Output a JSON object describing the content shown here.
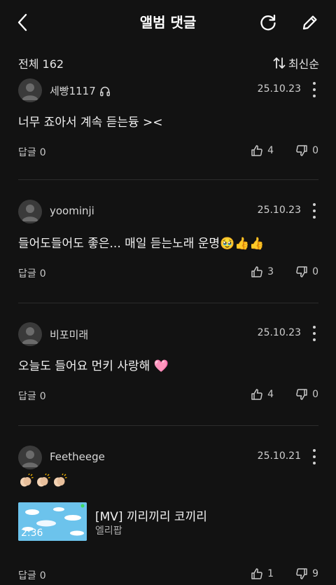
{
  "header": {
    "title": "앨범 댓글",
    "back_icon": "chevron-left-icon",
    "refresh_icon": "refresh-icon",
    "edit_icon": "pencil-icon"
  },
  "summary": {
    "total_label": "전체 162",
    "sort_label": "최신순",
    "sort_icon": "sort-arrows-icon"
  },
  "comments": [
    {
      "username": "세빵1117",
      "has_headphone_badge": true,
      "date": "25.10.23",
      "text": "너무 죠아서 계속 듣는듕 ><",
      "reply_label": "답글",
      "reply_count": "0",
      "likes": "4",
      "dislikes": "0"
    },
    {
      "username": "yoominji",
      "date": "25.10.23",
      "text": "들어도들어도 좋은... 매일 듣는노래 운명🥹👍👍",
      "reply_label": "답글",
      "reply_count": "0",
      "likes": "3",
      "dislikes": "0"
    },
    {
      "username": "비포미래",
      "date": "25.10.23",
      "text": "오늘도 들어요 먼키 사랑해 🩷",
      "reply_label": "답글",
      "reply_count": "0",
      "likes": "4",
      "dislikes": "0"
    },
    {
      "username": "Feetheege",
      "date": "25.10.21",
      "emoji": "clapping-hands x3",
      "attachment": {
        "title": "[MV] 끼리끼리 코끼리",
        "artist": "엘리팝",
        "duration": "2:36"
      },
      "reply_label": "답글",
      "reply_count": "0",
      "likes": "1",
      "dislikes": "9"
    }
  ],
  "colors": {
    "background": "#121212",
    "text": "#f2f2f2",
    "muted": "#c8c8c8",
    "divider": "#2c2c2c"
  }
}
